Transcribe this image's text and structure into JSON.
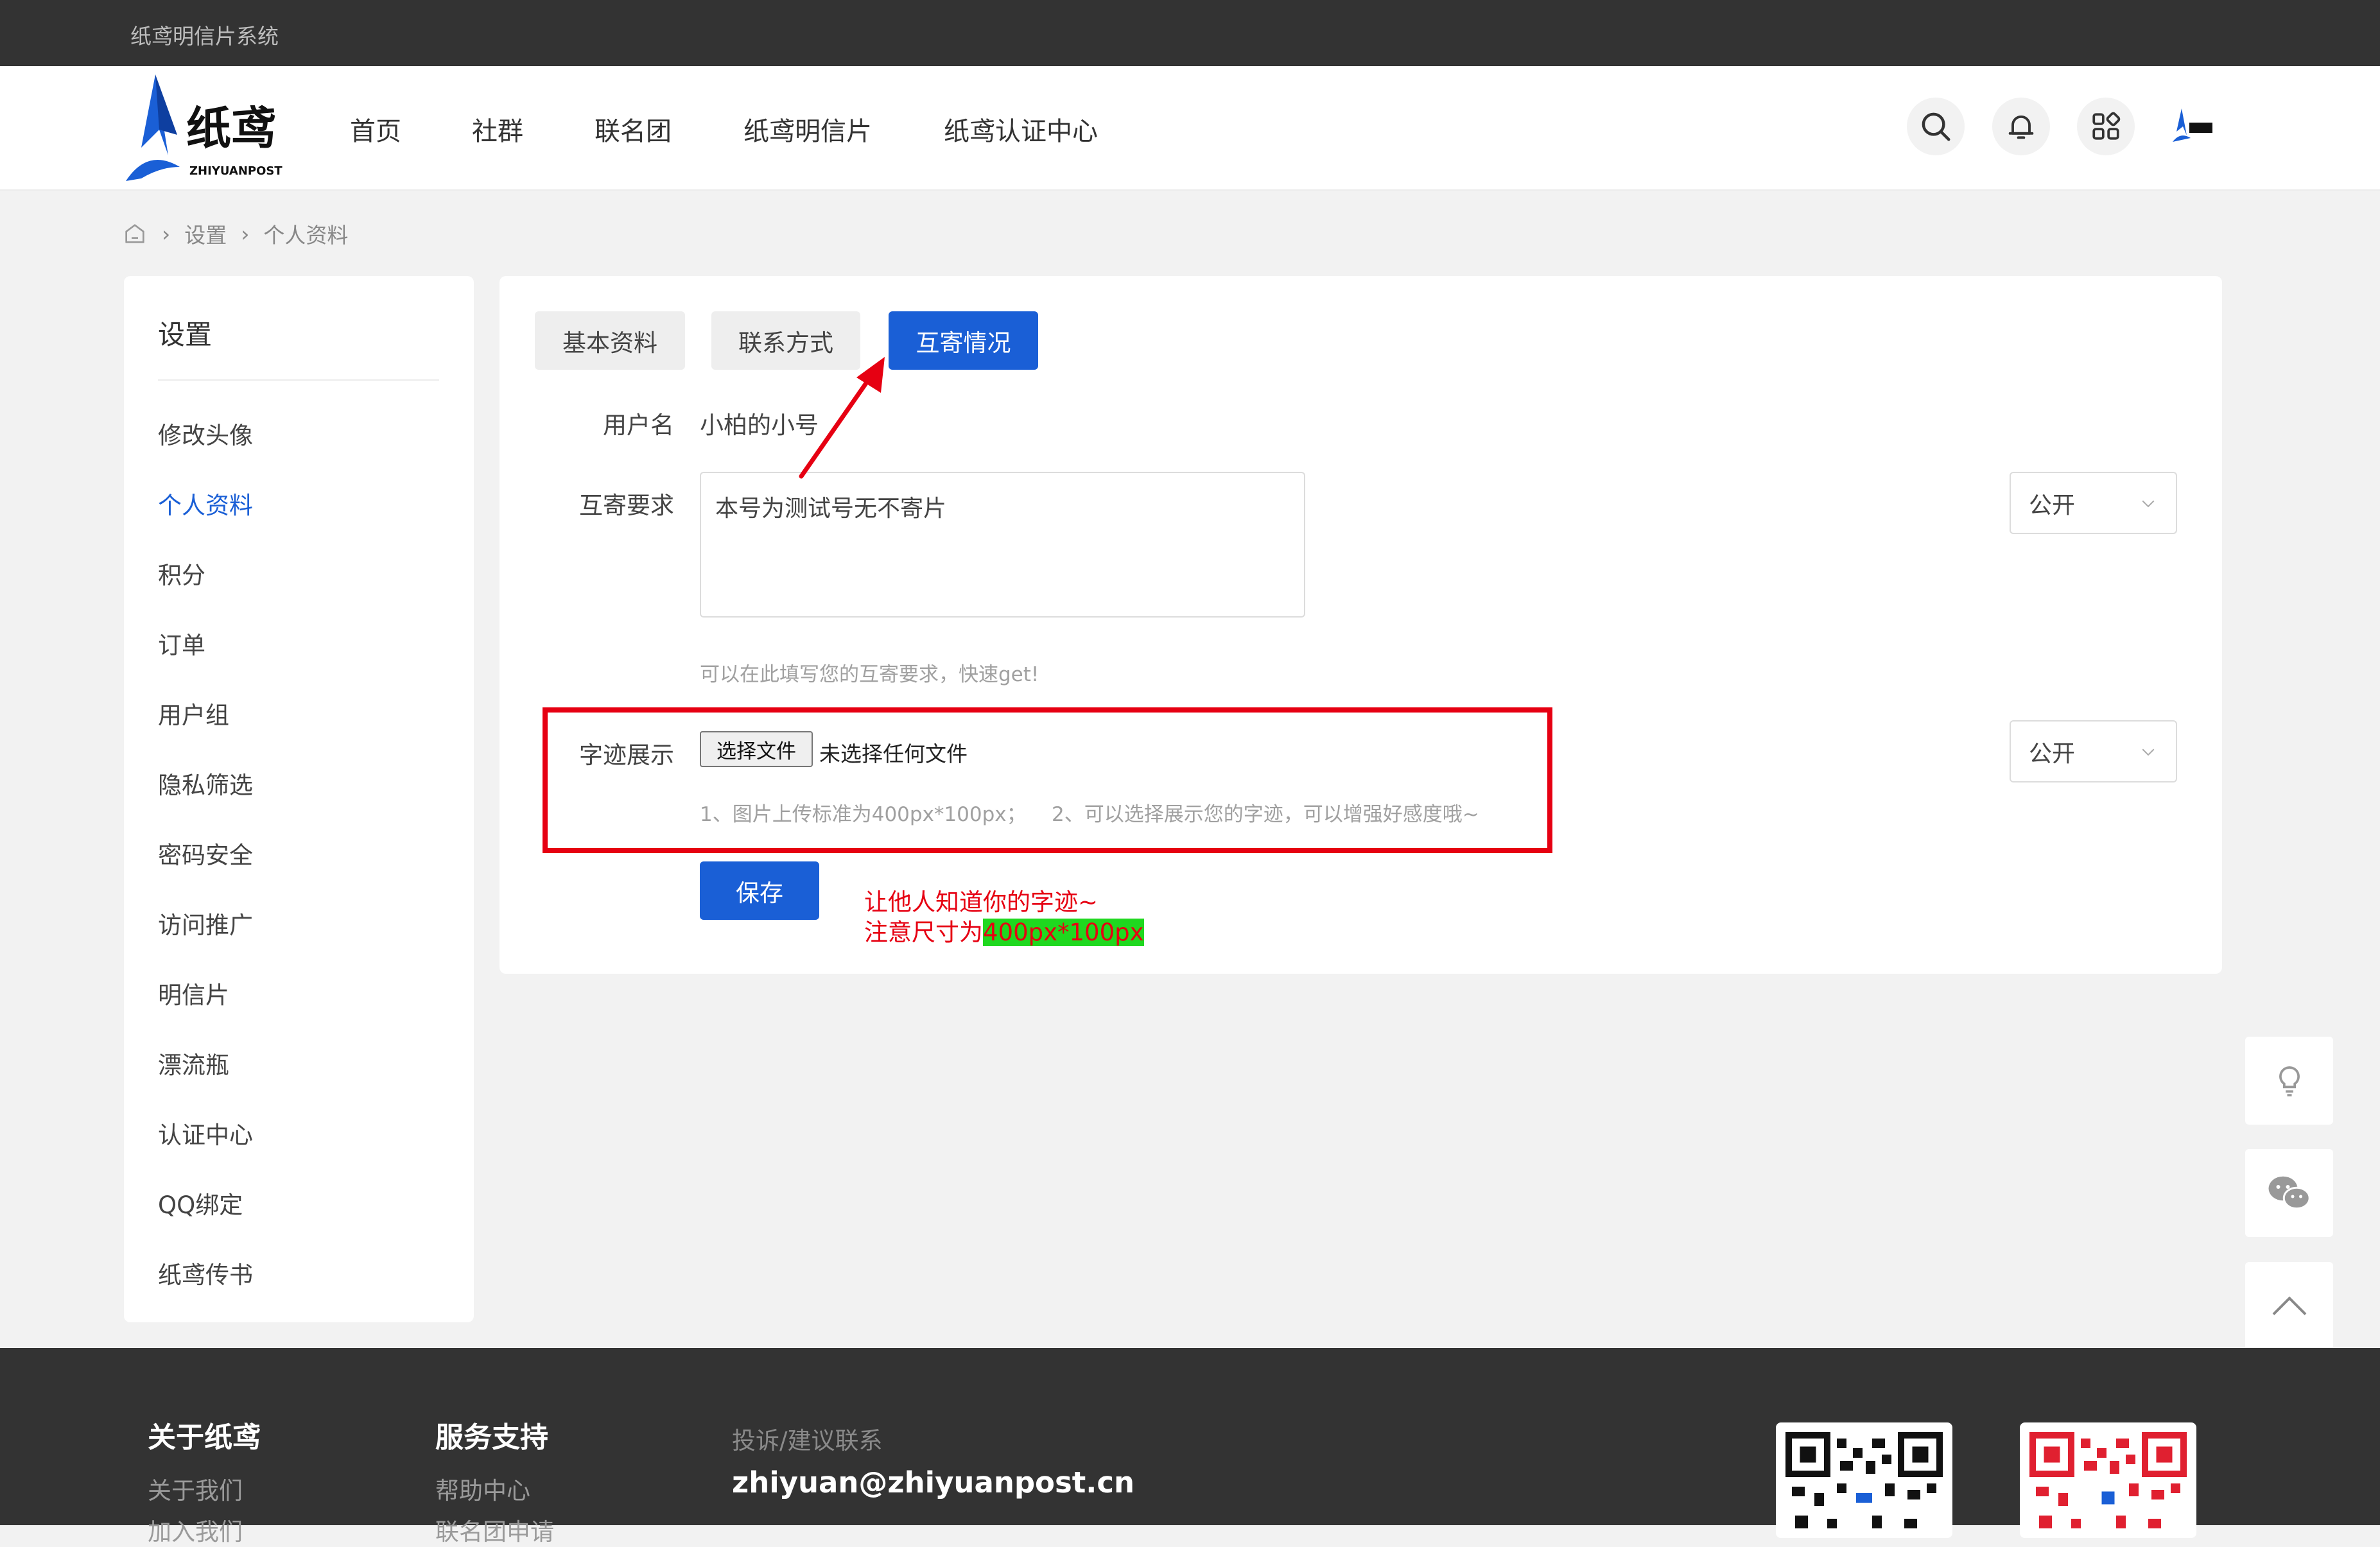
{
  "topbar": {
    "site_name": "纸鸢明信片系统"
  },
  "header": {
    "logo": {
      "brand_text": "纸鸢",
      "brand_sub": "ZHIYUANPOST"
    },
    "nav": [
      {
        "label": "首页"
      },
      {
        "label": "社群"
      },
      {
        "label": "联名团"
      },
      {
        "label": "纸鸢明信片"
      },
      {
        "label": "纸鸢认证中心"
      }
    ],
    "icons": [
      "search-icon",
      "bell-icon",
      "apps-grid-icon",
      "avatar"
    ]
  },
  "breadcrumb": {
    "items": [
      "设置",
      "个人资料"
    ],
    "separator": "›"
  },
  "sidebar": {
    "title": "设置",
    "items": [
      {
        "label": "修改头像"
      },
      {
        "label": "个人资料",
        "active": true
      },
      {
        "label": "积分"
      },
      {
        "label": "订单"
      },
      {
        "label": "用户组"
      },
      {
        "label": "隐私筛选"
      },
      {
        "label": "密码安全"
      },
      {
        "label": "访问推广"
      },
      {
        "label": "明信片"
      },
      {
        "label": "漂流瓶"
      },
      {
        "label": "认证中心"
      },
      {
        "label": "QQ绑定"
      },
      {
        "label": "纸鸢传书"
      }
    ]
  },
  "tabs": [
    {
      "label": "基本资料",
      "active": false
    },
    {
      "label": "联系方式",
      "active": false
    },
    {
      "label": "互寄情况",
      "active": true
    }
  ],
  "form": {
    "username": {
      "label": "用户名",
      "value": "小柏的小号"
    },
    "exchange": {
      "label": "互寄要求",
      "value": "本号为测试号无不寄片",
      "hint": "可以在此填写您的互寄要求，快速get!",
      "visibility": "公开"
    },
    "handwriting": {
      "label": "字迹展示",
      "button_label": "选择文件",
      "status": "未选择任何文件",
      "hint": "1、图片上传标准为400px*100px；    2、可以选择展示您的字迹，可以增强好感度哦~",
      "visibility": "公开"
    },
    "save_label": "保存"
  },
  "annotation": {
    "line1": "让他人知道你的字迹~",
    "line2_prefix": "注意尺寸为",
    "line2_highlight": "400px*100px",
    "colors": {
      "text": "#e60012",
      "highlight": "#1fd81f",
      "box": "#e60012"
    }
  },
  "floating": [
    "lightbulb-icon",
    "wechat-icon",
    "back-to-top-icon"
  ],
  "footer": {
    "col1": {
      "title": "关于纸鸢",
      "links": [
        "关于我们",
        "加入我们"
      ]
    },
    "col2": {
      "title": "服务支持",
      "links": [
        "帮助中心",
        "联名团申请"
      ]
    },
    "contact": {
      "label": "投诉/建议联系",
      "email": "zhiyuan@zhiyuanpost.cn"
    }
  },
  "colors": {
    "accent": "#1a5fd6",
    "topbar": "#333333",
    "footer": "#333333",
    "page_bg": "#f2f2f2"
  }
}
